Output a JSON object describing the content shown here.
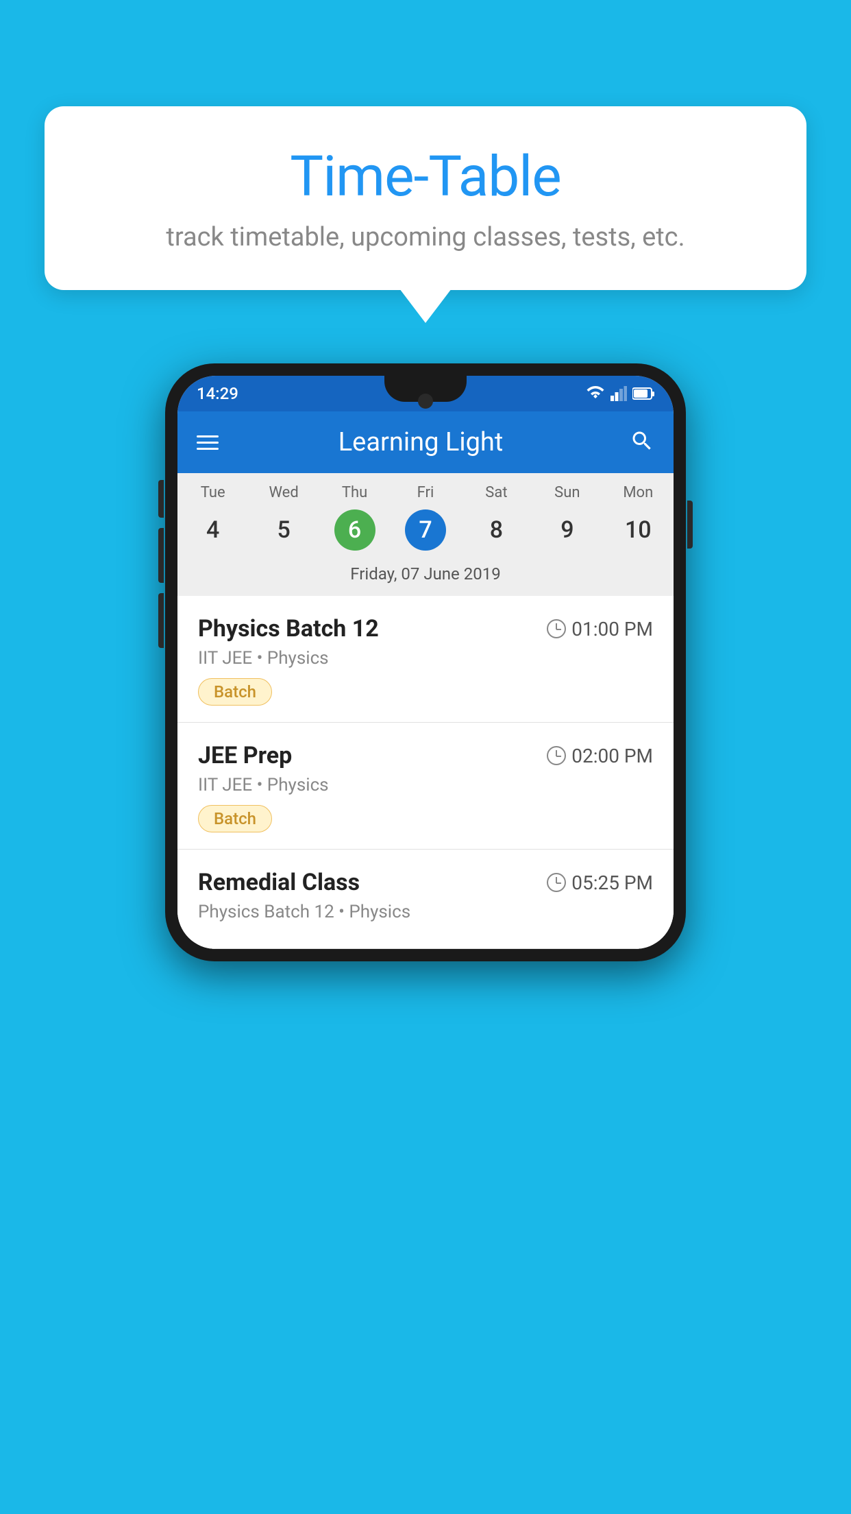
{
  "page": {
    "background_color": "#1ab8e8"
  },
  "tooltip": {
    "title": "Time-Table",
    "subtitle": "track timetable, upcoming classes, tests, etc."
  },
  "app_bar": {
    "title": "Learning Light",
    "menu_icon": "menu-icon",
    "search_icon": "search-icon"
  },
  "status_bar": {
    "time": "14:29"
  },
  "calendar": {
    "days": [
      {
        "label": "Tue",
        "number": "4"
      },
      {
        "label": "Wed",
        "number": "5"
      },
      {
        "label": "Thu",
        "number": "6",
        "state": "today"
      },
      {
        "label": "Fri",
        "number": "7",
        "state": "selected"
      },
      {
        "label": "Sat",
        "number": "8"
      },
      {
        "label": "Sun",
        "number": "9"
      },
      {
        "label": "Mon",
        "number": "10"
      }
    ],
    "selected_date_label": "Friday, 07 June 2019"
  },
  "schedule": {
    "items": [
      {
        "title": "Physics Batch 12",
        "time": "01:00 PM",
        "subtitle": "IIT JEE • Physics",
        "badge": "Batch"
      },
      {
        "title": "JEE Prep",
        "time": "02:00 PM",
        "subtitle": "IIT JEE • Physics",
        "badge": "Batch"
      },
      {
        "title": "Remedial Class",
        "time": "05:25 PM",
        "subtitle": "Physics Batch 12 • Physics",
        "badge": null
      }
    ]
  }
}
